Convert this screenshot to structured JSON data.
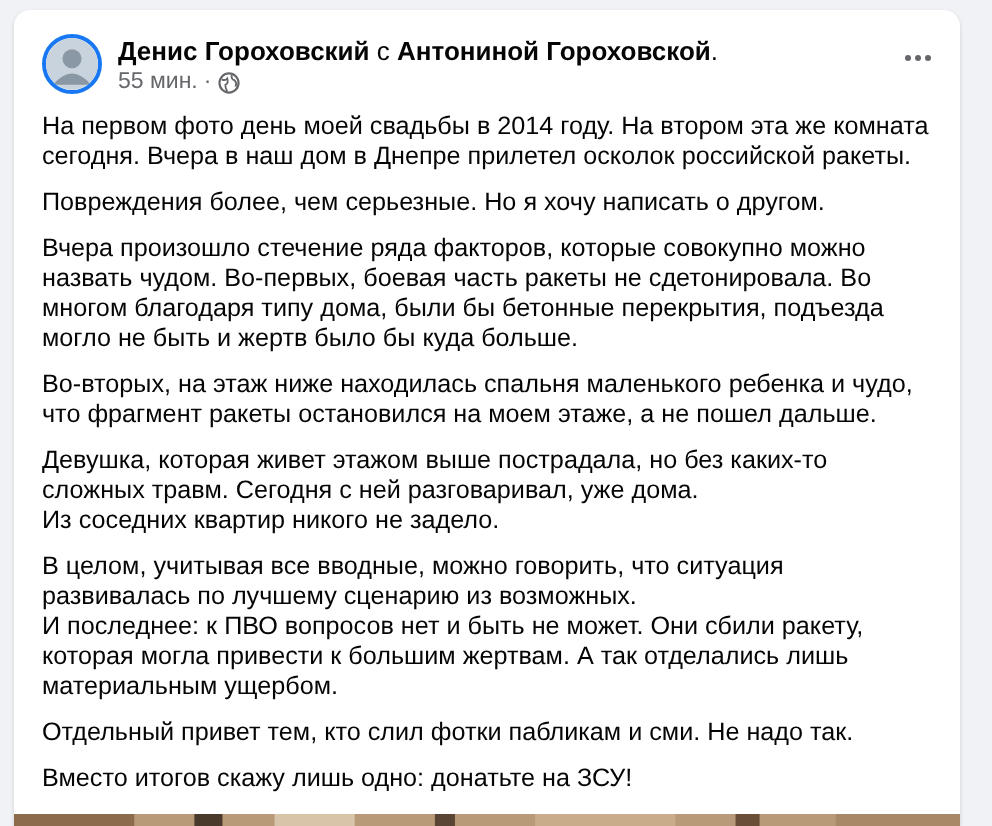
{
  "post": {
    "author": "Денис Гороховский",
    "connector": "с",
    "tagged": "Антониной Гороховской",
    "end": ".",
    "time": "55 мин.",
    "separator": "·",
    "paragraphs": [
      {
        "lines": [
          "На первом фото день моей свадьбы в 2014 году. На втором эта же комната сегодня. Вчера в наш дом в Днепре прилетел осколок российской ракеты."
        ]
      },
      {
        "lines": [
          "Повреждения более, чем серьезные. Но я хочу написать о другом."
        ]
      },
      {
        "lines": [
          "Вчера произошло стечение ряда факторов, которые совокупно можно назвать чудом. Во-первых, боевая часть ракеты не сдетонировала. Во многом благодаря типу дома, были бы бетонные перекрытия, подъезда могло не быть и жертв было бы куда больше."
        ]
      },
      {
        "lines": [
          "Во-вторых, на этаж ниже находилась спальня маленького ребенка и чудо, что фрагмент ракеты остановился на моем этаже, а не пошел дальше."
        ]
      },
      {
        "lines": [
          "Девушка, которая живет этажом выше пострадала, но без каких-то сложных травм. Сегодня с ней разговаривал, уже дома.",
          "Из соседних квартир никого не задело."
        ]
      },
      {
        "lines": [
          "В целом, учитывая все вводные, можно говорить, что ситуация развивалась по лучшему сценарию из возможных.",
          "И последнее: к ПВО вопросов нет и быть не может. Они сбили ракету, которая могла привести к большим жертвам. А так отделались лишь материальным ущербом."
        ]
      },
      {
        "lines": [
          "Отдельный привет тем, кто слил фотки пабликам и сми. Не надо так."
        ]
      },
      {
        "lines": [
          "Вместо итогов скажу лишь одно: донатьте на ЗСУ!"
        ]
      }
    ]
  }
}
